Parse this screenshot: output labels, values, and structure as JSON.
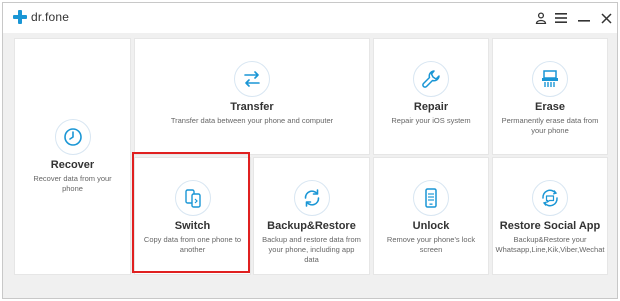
{
  "app": {
    "name": "dr.fone"
  },
  "titlebar": {
    "account_icon": "user-icon",
    "menu_icon": "hamburger-icon",
    "minimize_icon": "minimize-icon",
    "close_icon": "close-icon"
  },
  "colors": {
    "accent": "#1a96d5",
    "highlight": "#e02020"
  },
  "cards": {
    "recover": {
      "title": "Recover",
      "desc": "Recover data from your phone",
      "icon": "clock-icon"
    },
    "transfer": {
      "title": "Transfer",
      "desc": "Transfer data between your phone and computer",
      "icon": "transfer-arrows-icon"
    },
    "repair": {
      "title": "Repair",
      "desc": "Repair your iOS system",
      "icon": "wrench-icon"
    },
    "erase": {
      "title": "Erase",
      "desc": "Permanently erase data from your phone",
      "icon": "shredder-icon"
    },
    "switch": {
      "title": "Switch",
      "desc": "Copy data from one phone to another",
      "icon": "phone-switch-icon"
    },
    "backup": {
      "title": "Backup&Restore",
      "desc": "Backup and restore data from your phone, including app data",
      "icon": "sync-icon"
    },
    "unlock": {
      "title": "Unlock",
      "desc": "Remove your phone's lock screen",
      "icon": "phone-lock-icon"
    },
    "social": {
      "title": "Restore Social App",
      "desc": "Backup&Restore your Whatsapp,Line,Kik,Viber,Wechat",
      "icon": "social-restore-icon"
    }
  }
}
